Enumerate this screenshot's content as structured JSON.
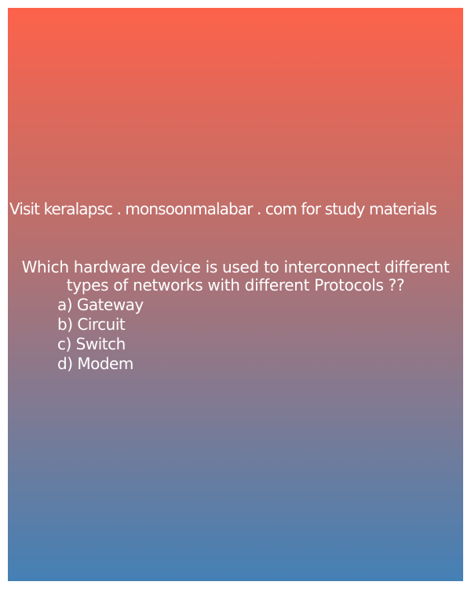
{
  "promo_text": "Visit keralapsc . monsoonmalabar . com for study materials",
  "question": "Which hardware device is used to interconnect different types of networks with different Protocols ??",
  "options": [
    "a) Gateway",
    "b) Circuit",
    "c) Switch",
    "d) Modem"
  ],
  "colors": {
    "gradient_top": "#fd624a",
    "gradient_bottom": "#4480b5",
    "text": "#ffffff"
  }
}
